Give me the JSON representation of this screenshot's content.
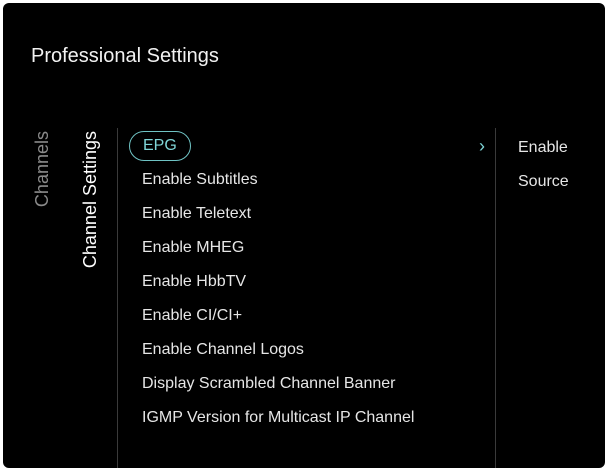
{
  "header": {
    "title": "Professional Settings"
  },
  "tabs": [
    {
      "label": "Channels"
    },
    {
      "label": "Channel Settings"
    }
  ],
  "menu": {
    "selected": {
      "label": "EPG",
      "chevron": "›"
    },
    "items": [
      {
        "label": "Enable Subtitles"
      },
      {
        "label": "Enable Teletext"
      },
      {
        "label": "Enable MHEG"
      },
      {
        "label": "Enable HbbTV"
      },
      {
        "label": "Enable CI/CI+"
      },
      {
        "label": "Enable Channel Logos"
      },
      {
        "label": "Display Scrambled Channel Banner"
      },
      {
        "label": "IGMP Version for Multicast IP Channel"
      }
    ]
  },
  "submenu": {
    "items": [
      {
        "label": "Enable"
      },
      {
        "label": "Source"
      }
    ]
  },
  "colors": {
    "background": "#000000",
    "accent": "#7fd6d8",
    "text": "#e6e6e6",
    "inactive_tab": "#8a8a8a"
  },
  "icons": {
    "chevron": "chevron-right-icon"
  }
}
